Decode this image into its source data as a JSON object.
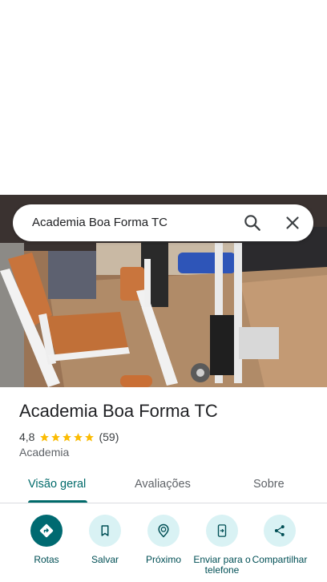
{
  "search": {
    "query": "Academia Boa Forma TC",
    "search_icon": "search-icon",
    "close_icon": "close-icon"
  },
  "place": {
    "name": "Academia Boa Forma TC",
    "rating": "4,8",
    "stars": 5,
    "review_count": "(59)",
    "category": "Academia"
  },
  "tabs": [
    {
      "label": "Visão geral",
      "active": true
    },
    {
      "label": "Avaliações",
      "active": false
    },
    {
      "label": "Sobre",
      "active": false
    }
  ],
  "actions": [
    {
      "label": "Rotas",
      "icon": "directions-icon"
    },
    {
      "label": "Salvar",
      "icon": "bookmark-icon"
    },
    {
      "label": "Próximo",
      "icon": "nearby-icon"
    },
    {
      "label": "Enviar para o telefone",
      "icon": "send-to-phone-icon"
    },
    {
      "label": "Compartilhar",
      "icon": "share-icon"
    }
  ],
  "colors": {
    "accent": "#006a71",
    "accent_light": "#d9f2f4",
    "star": "#fbbc04"
  }
}
